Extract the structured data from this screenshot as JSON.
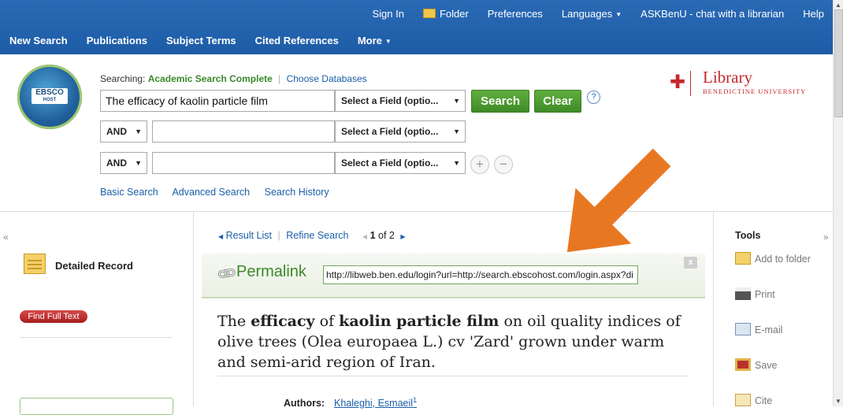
{
  "toplinks": {
    "sign_in": "Sign In",
    "folder": "Folder",
    "preferences": "Preferences",
    "languages": "Languages",
    "ask": "ASKBenU - chat with a librarian",
    "help": "Help"
  },
  "nav": {
    "new_search": "New Search",
    "publications": "Publications",
    "subject_terms": "Subject Terms",
    "cited_references": "Cited References",
    "more": "More"
  },
  "logo": {
    "main": "EBSCO",
    "sub": "HOST"
  },
  "search": {
    "searching_label": "Searching:",
    "database": "Academic Search Complete",
    "choose_databases": "Choose Databases",
    "row1_value": "The efficacy of kaolin particle film",
    "field_select": "Select a Field (optio...",
    "bool_op": "AND",
    "search_btn": "Search",
    "clear_btn": "Clear",
    "help": "?",
    "plus": "+",
    "minus": "−",
    "basic": "Basic Search",
    "advanced": "Advanced Search",
    "history": "Search History"
  },
  "library": {
    "name": "Library",
    "university": "BENEDICTINE UNIVERSITY"
  },
  "left": {
    "detailed_record": "Detailed Record",
    "find_full_text": "Find Full Text"
  },
  "result_nav": {
    "result_list": "Result List",
    "refine_search": "Refine Search",
    "current": "1",
    "of": "of",
    "total": "2"
  },
  "permalink": {
    "label": "Permalink",
    "url": "http://libweb.ben.edu/login?url=http://search.ebscohost.com/login.aspx?di",
    "close": "x"
  },
  "record": {
    "title_parts": [
      "The ",
      "efficacy",
      " of ",
      "kaolin particle film",
      " on oil quality indices of olive trees (Olea europaea L.) cv 'Zard' grown under warm and semi-arid region of Iran."
    ],
    "authors_label": "Authors:",
    "author_1": "Khaleghi, Esmaeil",
    "author_1_sup": "1"
  },
  "tools": {
    "title": "Tools",
    "add_to_folder": "Add to folder",
    "print": "Print",
    "email": "E-mail",
    "save": "Save",
    "cite": "Cite"
  },
  "colors": {
    "accent_blue": "#1d5ca6",
    "green": "#3f8b28",
    "arrow": "#e87722",
    "brand_red": "#c4282d"
  }
}
